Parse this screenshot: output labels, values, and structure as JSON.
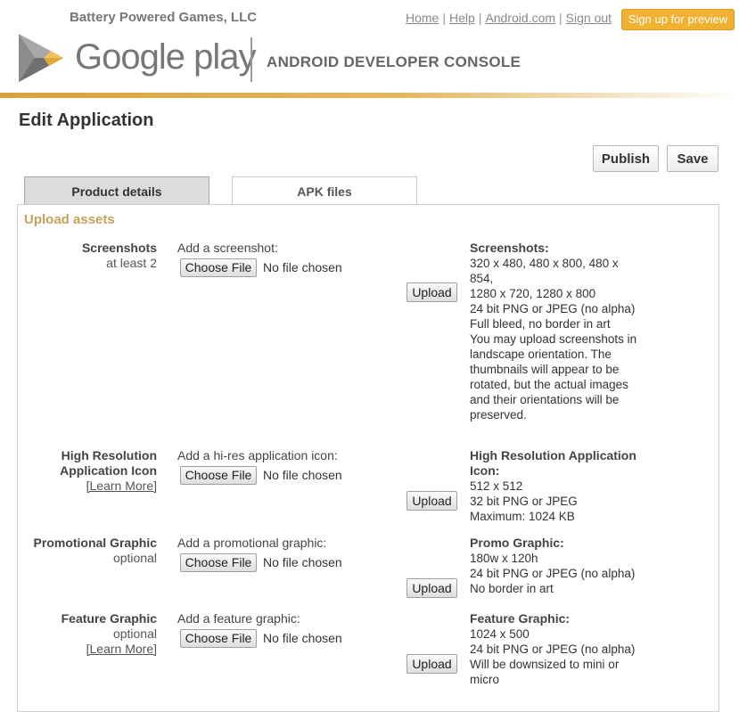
{
  "header": {
    "developer_name": "Battery Powered Games, LLC",
    "links": [
      "Home",
      "Help",
      "Android.com",
      "Sign out"
    ],
    "separator": "|",
    "signup_button": "Sign up for preview",
    "logo_text": "Google play",
    "console_title": "ANDROID DEVELOPER CONSOLE"
  },
  "page": {
    "title": "Edit Application",
    "publish_button": "Publish",
    "save_button": "Save"
  },
  "tabs": [
    {
      "label": "Product details",
      "active": true
    },
    {
      "label": "APK files",
      "active": false
    }
  ],
  "section": {
    "title": "Upload assets"
  },
  "file_input": {
    "choose_label": "Choose File",
    "no_file": "No file chosen",
    "upload_label": "Upload"
  },
  "assets": [
    {
      "label": "Screenshots",
      "sub": "at least 2",
      "link": "",
      "prompt": "Add a screenshot:",
      "info_title": "Screenshots:",
      "info_lines": [
        "320 x 480, 480 x 800, 480 x",
        "854,",
        "1280 x 720, 1280 x 800",
        "24 bit PNG or JPEG (no alpha)",
        "Full bleed, no border in art",
        "You may upload screenshots in",
        "landscape orientation. The",
        "thumbnails will appear to be",
        "rotated, but the actual images",
        "and their orientations will be",
        "preserved."
      ]
    },
    {
      "label": "High Resolution",
      "label2": "Application Icon",
      "sub": "",
      "link": "[Learn More]",
      "prompt": "Add a hi-res application icon:",
      "info_title": "High Resolution Application",
      "info_title2": "Icon:",
      "info_lines": [
        "512 x 512",
        "32 bit PNG or JPEG",
        "Maximum: 1024 KB"
      ]
    },
    {
      "label": "Promotional Graphic",
      "sub": "optional",
      "link": "",
      "prompt": "Add a promotional graphic:",
      "info_title": "Promo Graphic:",
      "info_lines": [
        "180w x 120h",
        "24 bit PNG or JPEG (no alpha)",
        "No border in art"
      ]
    },
    {
      "label": "Feature Graphic",
      "sub": "optional",
      "link": "[Learn More]",
      "prompt": "Add a feature graphic:",
      "info_title": "Feature Graphic:",
      "info_lines": [
        "1024 x 500",
        "24 bit PNG or JPEG (no alpha)",
        "Will be downsized to mini or",
        "micro"
      ]
    }
  ],
  "colors": {
    "accent": "#d9a23a",
    "section_title": "#c8a15b",
    "signup": "#f0b030"
  }
}
